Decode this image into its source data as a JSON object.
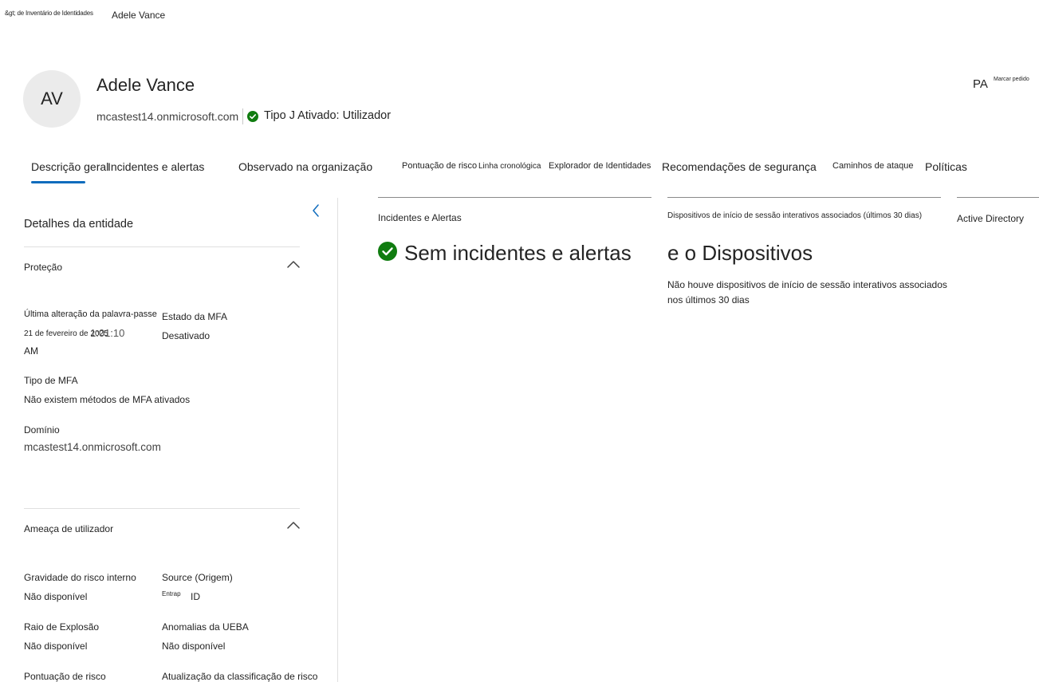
{
  "breadcrumb": {
    "previous": "&gt; de Inventário de Identidades",
    "current": "Adele Vance"
  },
  "header": {
    "avatar_initials": "AV",
    "name": "Adele Vance",
    "domain": "mcastest14.onmicrosoft.com",
    "user_type": "Tipo J Ativado: Utilizador",
    "status_color": "#107c10",
    "right_initials": "PA",
    "mark_label": "Marcar pedido"
  },
  "tabs": [
    {
      "label": "Descrição geral",
      "selected": true
    },
    {
      "label": "Incidentes e alertas"
    },
    {
      "label": "Observado na organização"
    },
    {
      "label": "Pontuação de risco"
    },
    {
      "label": "Linha cronológica"
    },
    {
      "label": "Explorador de Identidades"
    },
    {
      "label": "Recomendações de segurança"
    },
    {
      "label": "Caminhos de ataque"
    },
    {
      "label": "Políticas"
    }
  ],
  "entity_panel": {
    "title": "Detalhes da entidade",
    "protection": {
      "title": "Proteção",
      "last_pw_label": "Última alteração da palavra-passe",
      "last_pw_value_line1": "21 de fevereiro de 2025",
      "last_pw_value_time": "1:01:10",
      "last_pw_value_line2": "AM",
      "mfa_state_label": "Estado da MFA",
      "mfa_state_value": "Desativado",
      "mfa_type_label": "Tipo de MFA",
      "mfa_type_value": "Não existem métodos de MFA ativados",
      "domain_label": "Domínio",
      "domain_value": "mcastest14.onmicrosoft.com"
    },
    "user_threat": {
      "title": "Ameaça de utilizador",
      "insider_label": "Gravidade do risco interno",
      "insider_value": "Não disponível",
      "source_label": "Source (Origem)",
      "source_value_small": "Entrap",
      "source_value": "ID",
      "blast_label": "Raio de Explosão",
      "blast_value": "Não disponível",
      "ueba_label": "Anomalias da UEBA",
      "ueba_value": "Não disponível",
      "risk_score_label": "Pontuação de risco",
      "risk_update_label": "Atualização da classificação de risco"
    }
  },
  "cards": {
    "incidents": {
      "title": "Incidentes e Alertas",
      "message": "Sem incidentes e alertas"
    },
    "devices": {
      "title": "Dispositivos de início de sessão interativos associados (últimos 30 dias)",
      "heading": "e o Dispositivos",
      "description": "Não houve dispositivos de início de sessão interativos associados nos últimos 30 dias"
    },
    "active_directory": {
      "title": "Active Directory"
    }
  }
}
